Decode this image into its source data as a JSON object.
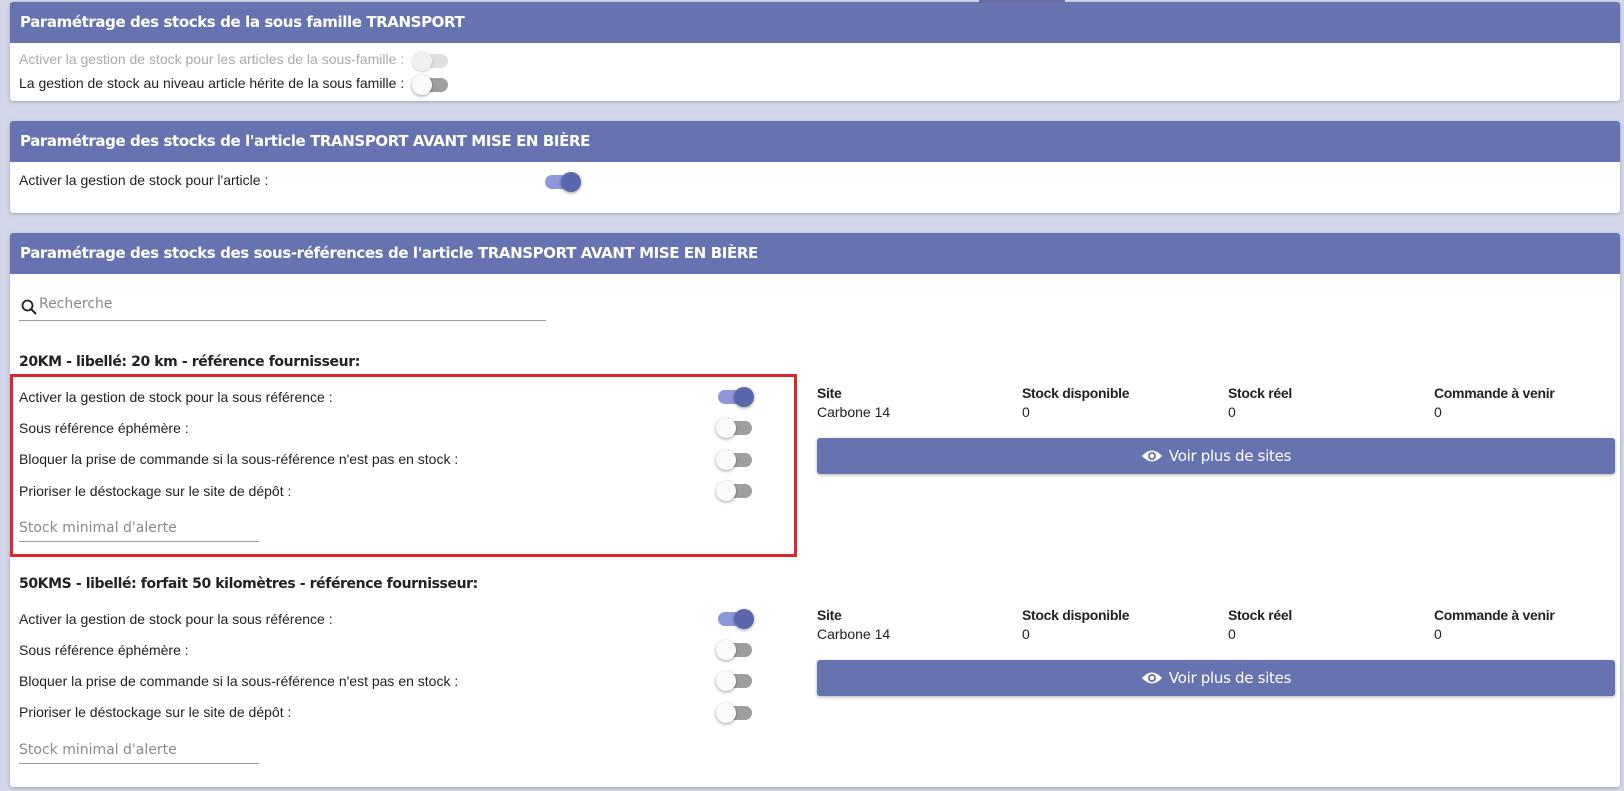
{
  "subfamily_panel": {
    "title": "Paramétrage des stocks de la sous famille TRANSPORT",
    "enable_label": "Activer la gestion de stock pour les articles de la sous-famille :",
    "inherit_label": "La gestion de stock au niveau article hérite de la sous famille :"
  },
  "article_panel": {
    "title": "Paramétrage des stocks de l'article TRANSPORT AVANT MISE EN BIÈRE",
    "enable_label": "Activer la gestion de stock pour l'article :"
  },
  "subref_panel": {
    "title": "Paramétrage des stocks des sous-références de l'article TRANSPORT AVANT MISE EN BIÈRE",
    "search_placeholder": "Recherche",
    "subrefs": [
      {
        "title": "20KM - libellé: 20 km - référence fournisseur:",
        "enable_label": "Activer la gestion de stock pour la sous référence :",
        "ephemeral_label": "Sous référence éphémère :",
        "block_label": "Bloquer la prise de commande si la sous-référence n'est pas en stock :",
        "prioritize_label": "Prioriser le déstockage sur le site de dépôt :",
        "min_stock_placeholder": "Stock minimal d'alerte",
        "table": {
          "headers": [
            "Site",
            "Stock disponible",
            "Stock réel",
            "Commande à venir"
          ],
          "row": [
            "Carbone 14",
            "0",
            "0",
            "0"
          ]
        },
        "more_button": "Voir plus de sites"
      },
      {
        "title": "50KMS - libellé: forfait 50 kilomètres - référence fournisseur:",
        "enable_label": "Activer la gestion de stock pour la sous référence :",
        "ephemeral_label": "Sous référence éphémère :",
        "block_label": "Bloquer la prise de commande si la sous-référence n'est pas en stock :",
        "prioritize_label": "Prioriser le déstockage sur le site de dépôt :",
        "min_stock_placeholder": "Stock minimal d'alerte",
        "table": {
          "headers": [
            "Site",
            "Stock disponible",
            "Stock réel",
            "Commande à venir"
          ],
          "row": [
            "Carbone 14",
            "0",
            "0",
            "0"
          ]
        },
        "more_button": "Voir plus de sites"
      }
    ]
  },
  "colors": {
    "header_bg": "#6673b0",
    "toggle_on": "#5a66ad",
    "highlight": "#e0262c",
    "page_bg": "#d3d6e8"
  }
}
